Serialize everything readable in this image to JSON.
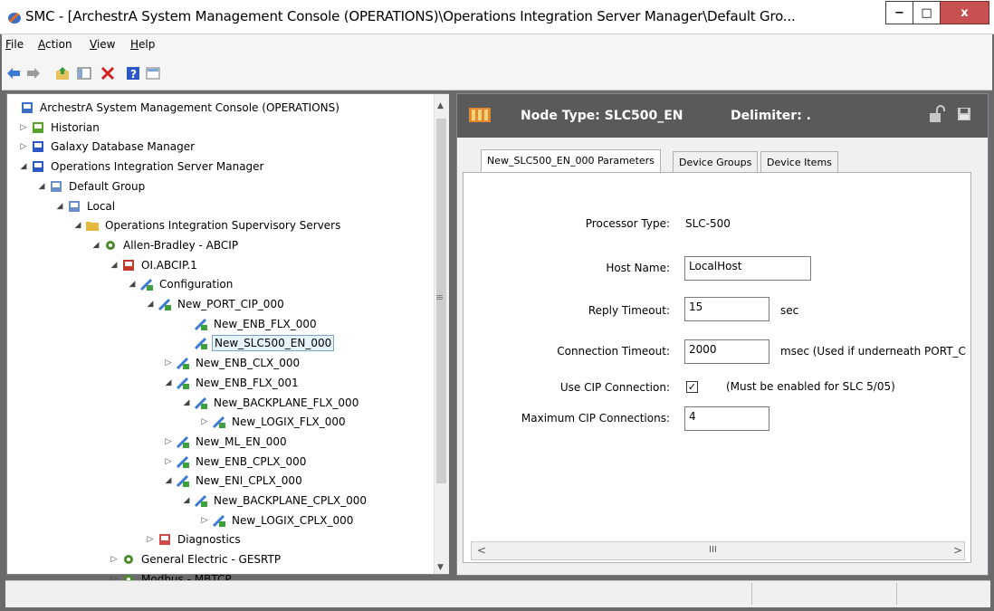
{
  "window": {
    "title": "SMC - [ArchestrA System Management Console (OPERATIONS)\\Operations Integration Server Manager\\Default Gro...",
    "minimize_glyph": "−",
    "maximize_glyph": "□",
    "close_glyph": "x"
  },
  "menubar": {
    "items": [
      {
        "label": "File",
        "mnemonic": "F"
      },
      {
        "label": "Action",
        "mnemonic": "A"
      },
      {
        "label": "View",
        "mnemonic": "V"
      },
      {
        "label": "Help",
        "mnemonic": "H"
      }
    ]
  },
  "toolbar": {
    "buttons": [
      "back-arrow-icon",
      "forward-arrow-icon",
      "up-folder-icon",
      "show-hide-tree-icon",
      "delete-icon",
      "help-icon",
      "properties-icon"
    ]
  },
  "tree": {
    "items": [
      {
        "label": "ArchestrA System Management Console (OPERATIONS)",
        "icon": "archestra-icon",
        "exp": ""
      },
      {
        "label": "Historian",
        "icon": "historian-icon",
        "exp": "▷"
      },
      {
        "label": "Galaxy Database Manager",
        "icon": "database-manager-icon",
        "exp": "▷"
      },
      {
        "label": "Operations Integration Server Manager",
        "icon": "server-manager-icon",
        "exp": "◢"
      },
      {
        "label": "Default Group",
        "icon": "group-icon",
        "exp": "◢"
      },
      {
        "label": "Local",
        "icon": "computer-icon",
        "exp": "◢"
      },
      {
        "label": "Operations Integration Supervisory Servers",
        "icon": "folder-icon",
        "exp": "◢"
      },
      {
        "label": "Allen-Bradley - ABCIP",
        "icon": "gear-icon",
        "exp": "◢"
      },
      {
        "label": "OI.ABCIP.1",
        "icon": "server-instance-icon",
        "exp": "◢"
      },
      {
        "label": "Configuration",
        "icon": "configuration-icon",
        "exp": "◢"
      },
      {
        "label": "New_PORT_CIP_000",
        "icon": "port-icon",
        "exp": "◢"
      },
      {
        "label": "New_ENB_FLX_000",
        "icon": "device-icon",
        "exp": ""
      },
      {
        "label": "New_SLC500_EN_000",
        "icon": "device-icon",
        "exp": ""
      },
      {
        "label": "New_ENB_CLX_000",
        "icon": "device-icon",
        "exp": "▷"
      },
      {
        "label": "New_ENB_FLX_001",
        "icon": "device-icon",
        "exp": "◢"
      },
      {
        "label": "New_BACKPLANE_FLX_000",
        "icon": "device-icon",
        "exp": "◢"
      },
      {
        "label": "New_LOGIX_FLX_000",
        "icon": "device-icon",
        "exp": "▷"
      },
      {
        "label": "New_ML_EN_000",
        "icon": "device-icon",
        "exp": "▷"
      },
      {
        "label": "New_ENB_CPLX_000",
        "icon": "device-icon",
        "exp": "▷"
      },
      {
        "label": "New_ENI_CPLX_000",
        "icon": "device-icon",
        "exp": "◢"
      },
      {
        "label": "New_BACKPLANE_CPLX_000",
        "icon": "device-icon",
        "exp": "◢"
      },
      {
        "label": "New_LOGIX_CPLX_000",
        "icon": "device-icon",
        "exp": "▷"
      },
      {
        "label": "Diagnostics",
        "icon": "diagnostics-icon",
        "exp": "▷"
      },
      {
        "label": "General Electric - GESRTP",
        "icon": "gear-icon",
        "exp": "▷"
      },
      {
        "label": "Modbus - MBTCP",
        "icon": "gear-icon",
        "exp": "▷"
      }
    ],
    "selected_label": "New_SLC500_EN_000"
  },
  "node_header": {
    "node_type": "Node Type: SLC500_EN",
    "delimiter": "Delimiter: ."
  },
  "tabs": [
    {
      "label": "New_SLC500_EN_000 Parameters",
      "active": true
    },
    {
      "label": "Device Groups",
      "active": false
    },
    {
      "label": "Device Items",
      "active": false
    }
  ],
  "params": {
    "processor_type_label": "Processor Type:",
    "processor_type_value": "SLC-500",
    "host_name_label": "Host Name:",
    "host_name_value": "LocalHost",
    "reply_timeout_label": "Reply Timeout:",
    "reply_timeout_value": "15",
    "reply_timeout_unit": "sec",
    "connection_timeout_label": "Connection Timeout:",
    "connection_timeout_value": "2000",
    "connection_timeout_unit": "msec  (Used if underneath PORT_C",
    "use_cip_label": "Use CIP Connection:",
    "use_cip_checked": "✓",
    "use_cip_note": "(Must be enabled for SLC 5/05)",
    "max_cip_label": "Maximum CIP Connections:",
    "max_cip_value": "4"
  },
  "hscroll": {
    "left": "<",
    "right": ">",
    "thumb": "III"
  },
  "colors": {
    "header_bg": "#5a5a5a",
    "selection_border": "#7da2ce",
    "close_button": "#c75050"
  }
}
